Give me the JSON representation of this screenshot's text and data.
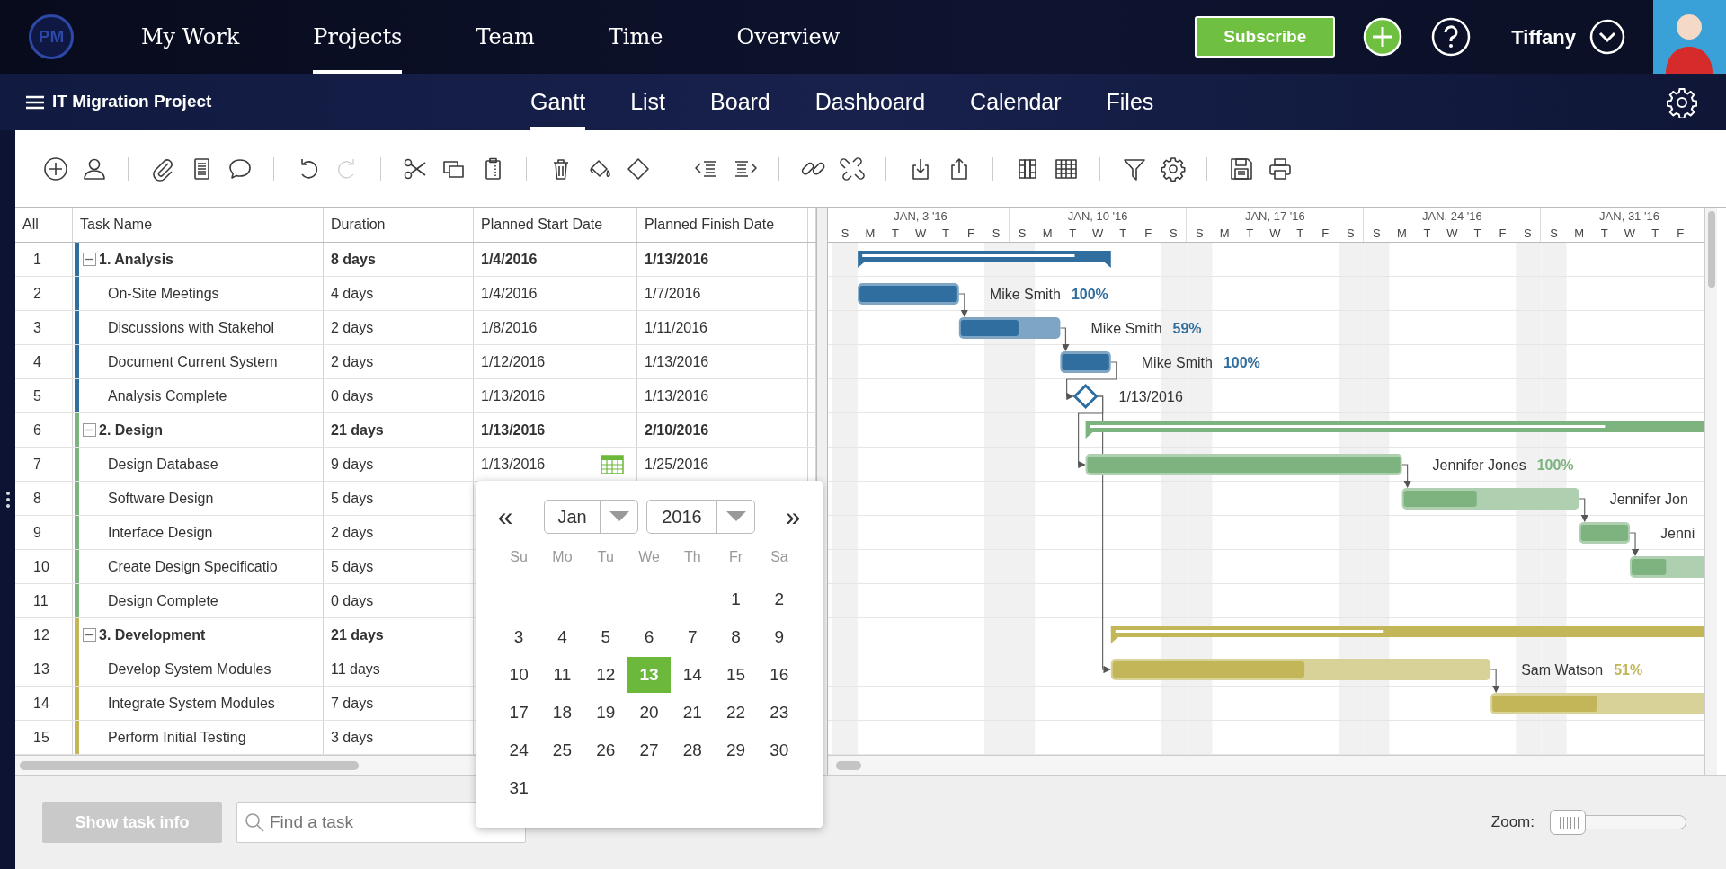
{
  "top_nav": {
    "logo": "PM",
    "items": [
      {
        "label": "My Work",
        "selected": false
      },
      {
        "label": "Projects",
        "selected": true
      },
      {
        "label": "Team",
        "selected": false
      },
      {
        "label": "Time",
        "selected": false
      },
      {
        "label": "Overview",
        "selected": false
      }
    ],
    "subscribe": "Subscribe",
    "user": "Tiffany"
  },
  "project_bar": {
    "title": "IT Migration Project",
    "tabs": [
      {
        "label": "Gantt",
        "selected": true
      },
      {
        "label": "List",
        "selected": false
      },
      {
        "label": "Board",
        "selected": false
      },
      {
        "label": "Dashboard",
        "selected": false
      },
      {
        "label": "Calendar",
        "selected": false
      },
      {
        "label": "Files",
        "selected": false
      }
    ]
  },
  "toolbar": [
    [
      {
        "disabled": false
      },
      {
        "disabled": false
      }
    ],
    [
      {
        "disabled": false
      },
      {
        "disabled": false
      },
      {
        "disabled": false
      }
    ],
    [
      {
        "disabled": false
      },
      {
        "disabled": true
      }
    ],
    [
      {
        "disabled": false
      },
      {
        "disabled": false
      },
      {
        "disabled": false
      }
    ],
    [
      {
        "disabled": false
      },
      {
        "disabled": false
      },
      {
        "disabled": false
      }
    ],
    [
      {
        "disabled": false
      },
      {
        "disabled": false
      }
    ],
    [
      {
        "disabled": false
      },
      {
        "disabled": false
      }
    ],
    [
      {
        "disabled": false
      },
      {
        "disabled": false
      }
    ],
    [
      {
        "disabled": false
      },
      {
        "disabled": false
      }
    ],
    [
      {
        "disabled": false
      },
      {
        "disabled": false
      }
    ],
    [
      {
        "disabled": false
      },
      {
        "disabled": false
      }
    ]
  ],
  "grid": {
    "columns": [
      "All",
      "Task Name",
      "Duration",
      "Planned Start Date",
      "Planned Finish Date"
    ],
    "rows": [
      {
        "num": "1",
        "name": "1. Analysis",
        "duration": "8 days",
        "start": "1/4/2016",
        "finish": "1/13/2016",
        "kind": "summary",
        "color": "#2f6e9e",
        "expanded": true,
        "editing": false,
        "gantt": {
          "level": 0.87
        },
        "children": [
          {
            "num": "2",
            "name": "On-Site Meetings",
            "duration": "4 days",
            "start": "1/4/2016",
            "finish": "1/7/2016",
            "kind": "task",
            "editing": false,
            "gantt": {
              "resource": "Mike Smith",
              "percent": "100%",
              "level": 1
            }
          },
          {
            "num": "3",
            "name": "Discussions with Stakehol",
            "duration": "2 days",
            "start": "1/8/2016",
            "finish": "1/11/2016",
            "kind": "task",
            "editing": false,
            "gantt": {
              "resource": "Mike Smith",
              "percent": "59%",
              "level": 0.59
            }
          },
          {
            "num": "4",
            "name": "Document Current System",
            "duration": "2 days",
            "start": "1/12/2016",
            "finish": "1/13/2016",
            "kind": "task",
            "editing": false,
            "gantt": {
              "resource": "Mike Smith",
              "percent": "100%",
              "level": 1
            }
          },
          {
            "num": "5",
            "name": "Analysis Complete",
            "duration": "0 days",
            "start": "1/13/2016",
            "finish": "1/13/2016",
            "kind": "milestone",
            "editing": false,
            "gantt": {
              "date_label": "1/13/2016"
            }
          }
        ]
      },
      {
        "num": "6",
        "name": "2. Design",
        "duration": "21 days",
        "start": "1/13/2016",
        "finish": "2/10/2016",
        "kind": "summary",
        "color": "#7db37f",
        "expanded": true,
        "editing": false,
        "gantt": {
          "level": 0.71
        },
        "children": [
          {
            "num": "7",
            "name": "Design Database",
            "duration": "9 days",
            "start": "1/13/2016",
            "finish": "1/25/2016",
            "kind": "task",
            "editing": true,
            "gantt": {
              "resource": "Jennifer Jones",
              "percent": "100%",
              "level": 1
            }
          },
          {
            "num": "8",
            "name": "Software Design",
            "duration": "5 days",
            "kind": "task",
            "editing": false,
            "gantt": {
              "resource": "Jennifer Jon",
              "level": 0.42
            }
          },
          {
            "num": "9",
            "name": "Interface Design",
            "duration": "2 days",
            "kind": "task",
            "editing": false,
            "gantt": {
              "resource": "Jenni",
              "level": 1
            }
          },
          {
            "num": "10",
            "name": "Create Design Specificatio",
            "duration": "5 days",
            "kind": "task",
            "editing": false,
            "gantt": {
              "level": 0.28
            }
          },
          {
            "num": "11",
            "name": "Design Complete",
            "duration": "0 days",
            "kind": "milestone",
            "editing": false
          }
        ]
      },
      {
        "num": "12",
        "name": "3. Development",
        "duration": "21 days",
        "kind": "summary",
        "color": "#c2b659",
        "expanded": true,
        "editing": false,
        "gantt": {
          "level": 0.37
        },
        "children": [
          {
            "num": "13",
            "name": "Develop System Modules",
            "duration": "11 days",
            "kind": "task",
            "editing": false,
            "gantt": {
              "resource": "Sam Watson",
              "percent": "51%",
              "level": 0.51
            }
          },
          {
            "num": "14",
            "name": "Integrate System Modules",
            "duration": "7 days",
            "kind": "task",
            "editing": false,
            "gantt": {
              "level": 0.42
            }
          },
          {
            "num": "15",
            "name": "Perform Initial Testing",
            "duration": "3 days",
            "kind": "task",
            "editing": false
          }
        ]
      }
    ]
  },
  "timeline": {
    "weeks": [
      {
        "label": "JAN, 3 '16",
        "days": [
          {
            "letter": "S",
            "weekend": true
          },
          {
            "letter": "M",
            "weekend": false
          },
          {
            "letter": "T",
            "weekend": false
          },
          {
            "letter": "W",
            "weekend": false
          },
          {
            "letter": "T",
            "weekend": false
          },
          {
            "letter": "F",
            "weekend": false
          },
          {
            "letter": "S",
            "weekend": true
          }
        ]
      },
      {
        "label": "JAN, 10 '16",
        "days": [
          {
            "letter": "S",
            "weekend": true
          },
          {
            "letter": "M",
            "weekend": false
          },
          {
            "letter": "T",
            "weekend": false
          },
          {
            "letter": "W",
            "weekend": false
          },
          {
            "letter": "T",
            "weekend": false
          },
          {
            "letter": "F",
            "weekend": false
          },
          {
            "letter": "S",
            "weekend": true
          }
        ]
      },
      {
        "label": "JAN, 17 '16",
        "days": [
          {
            "letter": "S",
            "weekend": true
          },
          {
            "letter": "M",
            "weekend": false
          },
          {
            "letter": "T",
            "weekend": false
          },
          {
            "letter": "W",
            "weekend": false
          },
          {
            "letter": "T",
            "weekend": false
          },
          {
            "letter": "F",
            "weekend": false
          },
          {
            "letter": "S",
            "weekend": true
          }
        ]
      },
      {
        "label": "JAN, 24 '16",
        "days": [
          {
            "letter": "S",
            "weekend": true
          },
          {
            "letter": "M",
            "weekend": false
          },
          {
            "letter": "T",
            "weekend": false
          },
          {
            "letter": "W",
            "weekend": false
          },
          {
            "letter": "T",
            "weekend": false
          },
          {
            "letter": "F",
            "weekend": false
          },
          {
            "letter": "S",
            "weekend": true
          }
        ]
      },
      {
        "label": "JAN, 31 '16",
        "days": [
          {
            "letter": "S",
            "weekend": true
          },
          {
            "letter": "M",
            "weekend": false
          },
          {
            "letter": "T",
            "weekend": false
          },
          {
            "letter": "W",
            "weekend": false
          },
          {
            "letter": "T",
            "weekend": false
          },
          {
            "letter": "F",
            "weekend": false
          }
        ]
      }
    ]
  },
  "date_picker": {
    "prev": "«",
    "month": "Jan",
    "year": "2016",
    "next": "»",
    "weekdays": [
      "Su",
      "Mo",
      "Tu",
      "We",
      "Th",
      "Fr",
      "Sa"
    ],
    "weeks": [
      [
        {
          "label": "1",
          "selected": false
        },
        {
          "label": "2",
          "selected": false
        }
      ],
      [
        {
          "label": "3",
          "selected": false
        },
        {
          "label": "4",
          "selected": false
        },
        {
          "label": "5",
          "selected": false
        },
        {
          "label": "6",
          "selected": false
        },
        {
          "label": "7",
          "selected": false
        },
        {
          "label": "8",
          "selected": false
        },
        {
          "label": "9",
          "selected": false
        }
      ],
      [
        {
          "label": "10",
          "selected": false
        },
        {
          "label": "11",
          "selected": false
        },
        {
          "label": "12",
          "selected": false
        },
        {
          "label": "13",
          "selected": true
        },
        {
          "label": "14",
          "selected": false
        },
        {
          "label": "15",
          "selected": false
        },
        {
          "label": "16",
          "selected": false
        }
      ],
      [
        {
          "label": "17",
          "selected": false
        },
        {
          "label": "18",
          "selected": false
        },
        {
          "label": "19",
          "selected": false
        },
        {
          "label": "20",
          "selected": false
        },
        {
          "label": "21",
          "selected": false
        },
        {
          "label": "22",
          "selected": false
        },
        {
          "label": "23",
          "selected": false
        }
      ],
      [
        {
          "label": "24",
          "selected": false
        },
        {
          "label": "25",
          "selected": false
        },
        {
          "label": "26",
          "selected": false
        },
        {
          "label": "27",
          "selected": false
        },
        {
          "label": "28",
          "selected": false
        },
        {
          "label": "29",
          "selected": false
        },
        {
          "label": "30",
          "selected": false
        }
      ],
      [
        {
          "label": "31",
          "selected": false
        }
      ]
    ]
  },
  "footer": {
    "show_info": {
      "label": "Show task info",
      "disabled": true
    },
    "search": {
      "placeholder": "Find a task"
    },
    "zoom": {
      "label": "Zoom:",
      "level": 0
    }
  }
}
